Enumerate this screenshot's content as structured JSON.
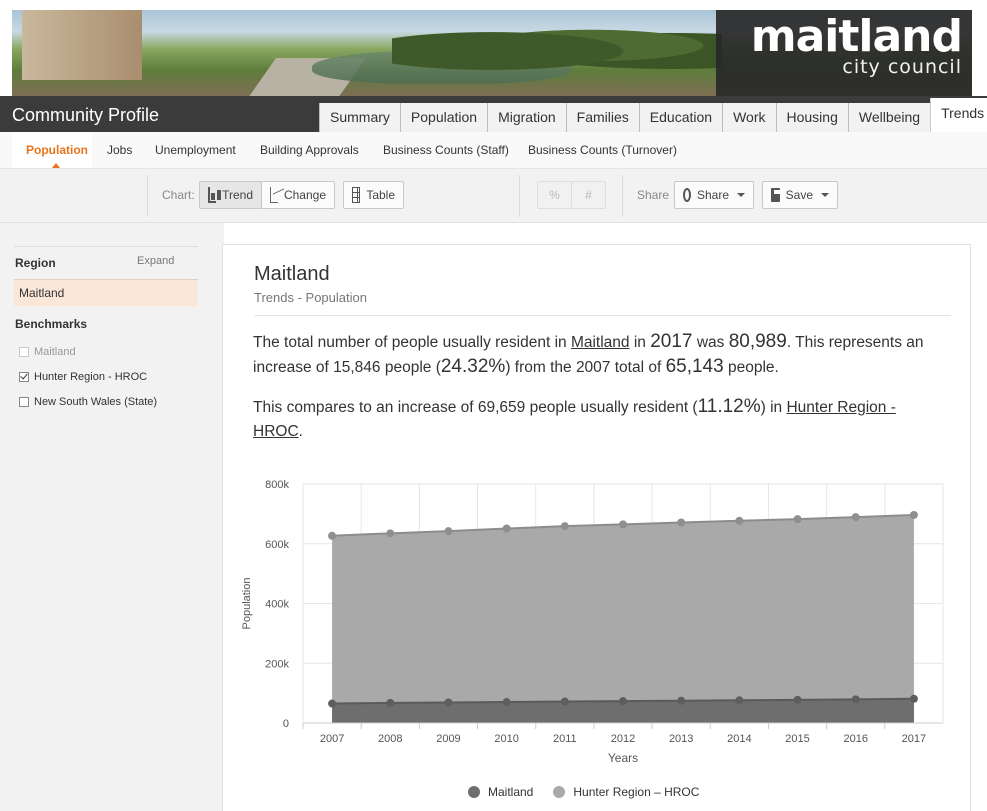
{
  "banner": {
    "logo_main": "maitland",
    "logo_sub": "city council"
  },
  "app_title": "Community Profile",
  "nav_tabs": [
    {
      "label": "Summary",
      "active": false
    },
    {
      "label": "Population",
      "active": false
    },
    {
      "label": "Migration",
      "active": false
    },
    {
      "label": "Families",
      "active": false
    },
    {
      "label": "Education",
      "active": false
    },
    {
      "label": "Work",
      "active": false
    },
    {
      "label": "Housing",
      "active": false
    },
    {
      "label": "Wellbeing",
      "active": false
    },
    {
      "label": "Trends",
      "active": true
    }
  ],
  "subnav": [
    {
      "label": "Population",
      "active": true
    },
    {
      "label": "Jobs",
      "active": false
    },
    {
      "label": "Unemployment",
      "active": false
    },
    {
      "label": "Building Approvals",
      "active": false
    },
    {
      "label": "Business Counts (Staff)",
      "active": false
    },
    {
      "label": "Business Counts (Turnover)",
      "active": false
    }
  ],
  "toolbar": {
    "chart_label": "Chart:",
    "trend_label": "Trend",
    "change_label": "Change",
    "table_label": "Table",
    "percent_label": "%",
    "number_label": "#",
    "share_label": "Share",
    "share_button_label": "Share",
    "save_label": "Save"
  },
  "left_panel": {
    "region_heading": "Region",
    "expand_label": "Expand",
    "region_selected": "Maitland",
    "benchmarks_heading": "Benchmarks",
    "benchmarks": [
      {
        "label": "Maitland",
        "checked": false,
        "disabled": true
      },
      {
        "label": "Hunter Region - HROC",
        "checked": true,
        "disabled": false
      },
      {
        "label": "New South Wales (State)",
        "checked": false,
        "disabled": false
      }
    ]
  },
  "content": {
    "title": "Maitland",
    "subtitle": "Trends - Population",
    "p1": {
      "t1": "The total number of people usually resident in ",
      "region": "Maitland",
      "t2": " in ",
      "year": "2017",
      "t3": " was ",
      "total": "80,989",
      "t4": ". This represents an increase of 15,846 people (",
      "pct": "24.32%",
      "t5": ") from the 2007 total of ",
      "base": "65,143",
      "t6": " people."
    },
    "p2": {
      "t1": "This compares to an increase of 69,659 people usually resident (",
      "pct": "11.12%",
      "t2": ") in ",
      "region": "Hunter Region - HROC",
      "t3": "."
    }
  },
  "chart_data": {
    "type": "area",
    "x": [
      2007,
      2008,
      2009,
      2010,
      2011,
      2012,
      2013,
      2014,
      2015,
      2016,
      2017
    ],
    "series": [
      {
        "name": "Maitland",
        "color": "#6e6e6e",
        "values": [
          65143,
          67200,
          68700,
          70200,
          71900,
          73200,
          74600,
          76000,
          77500,
          79200,
          80989
        ]
      },
      {
        "name": "Hunter Region – HROC",
        "color": "#a9a9a9",
        "values": [
          626700,
          634900,
          642200,
          651000,
          658800,
          664900,
          671200,
          676800,
          682400,
          689100,
          696359
        ]
      }
    ],
    "xlabel": "Years",
    "ylabel": "Population",
    "ylim": [
      0,
      800000
    ],
    "yticks": [
      "0",
      "200k",
      "400k",
      "600k",
      "800k"
    ],
    "ytick_values": [
      0,
      200000,
      400000,
      600000,
      800000
    ],
    "grid": true,
    "legend_position": "bottom"
  }
}
